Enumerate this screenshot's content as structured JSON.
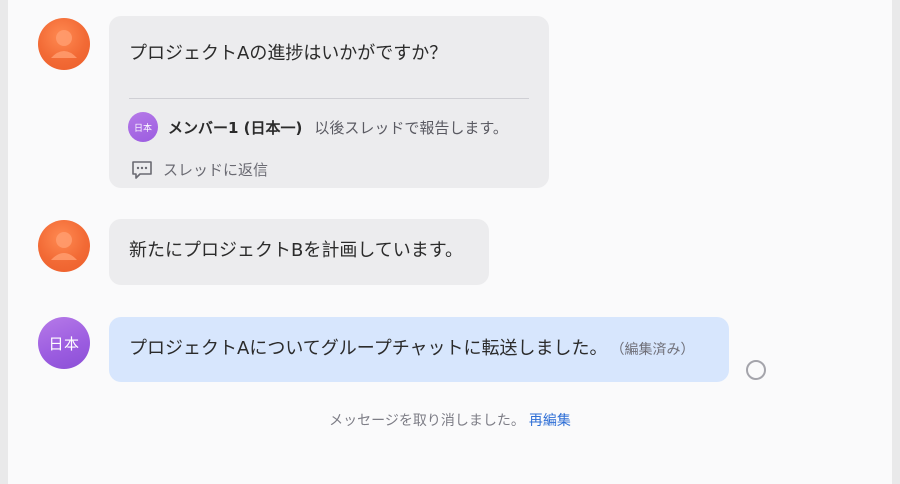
{
  "messages": [
    {
      "avatar": "person-icon",
      "text": "プロジェクトAの進捗はいかがですか？",
      "thread": {
        "reply_avatar_text": "日本",
        "reply_author": "メンバー1 (日本一)",
        "reply_text": "以後スレッドで報告します。",
        "reply_action_label": "スレッドに返信",
        "reply_action_icon": "reply-thread-icon"
      }
    },
    {
      "avatar": "person-icon",
      "text": "新たにプロジェクトBを計画しています。"
    },
    {
      "avatar_text": "日本",
      "text": "プロジェクトAについてグループチャットに転送しました。",
      "edited_label": "（編集済み）"
    }
  ],
  "recall_notice": {
    "text": "メッセージを取り消しました。",
    "reedit_label": "再編集"
  },
  "colors": {
    "avatar_orange": "#f26a35",
    "avatar_purple": "#9b5ce0",
    "bubble_gray": "#ececee",
    "bubble_blue": "#d7e6fd",
    "link_blue": "#2f6fd6"
  }
}
